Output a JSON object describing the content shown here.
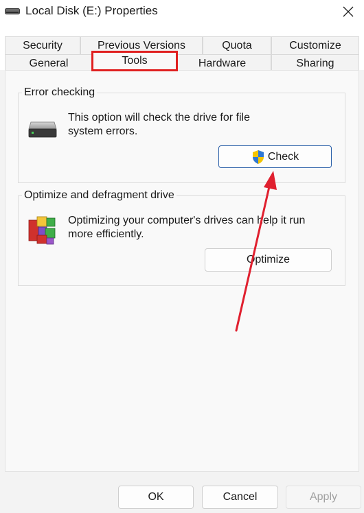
{
  "window": {
    "title": "Local Disk (E:) Properties"
  },
  "tabs": {
    "row1": [
      "Security",
      "Previous Versions",
      "Quota",
      "Customize"
    ],
    "row2": [
      "General",
      "Tools",
      "Hardware",
      "Sharing"
    ],
    "active": "Tools"
  },
  "error_checking": {
    "label": "Error checking",
    "description_line1": "This option will check the drive for file",
    "description_line2": "system errors.",
    "button": "Check"
  },
  "optimize": {
    "label": "Optimize and defragment drive",
    "description_line1": "Optimizing your computer's drives can help it run",
    "description_line2": "more efficiently.",
    "button": "Optimize"
  },
  "footer": {
    "ok": "OK",
    "cancel": "Cancel",
    "apply": "Apply"
  },
  "colors": {
    "highlight": "#e02020",
    "arrow": "#e0202f",
    "accent_border": "#2a5fa8"
  }
}
